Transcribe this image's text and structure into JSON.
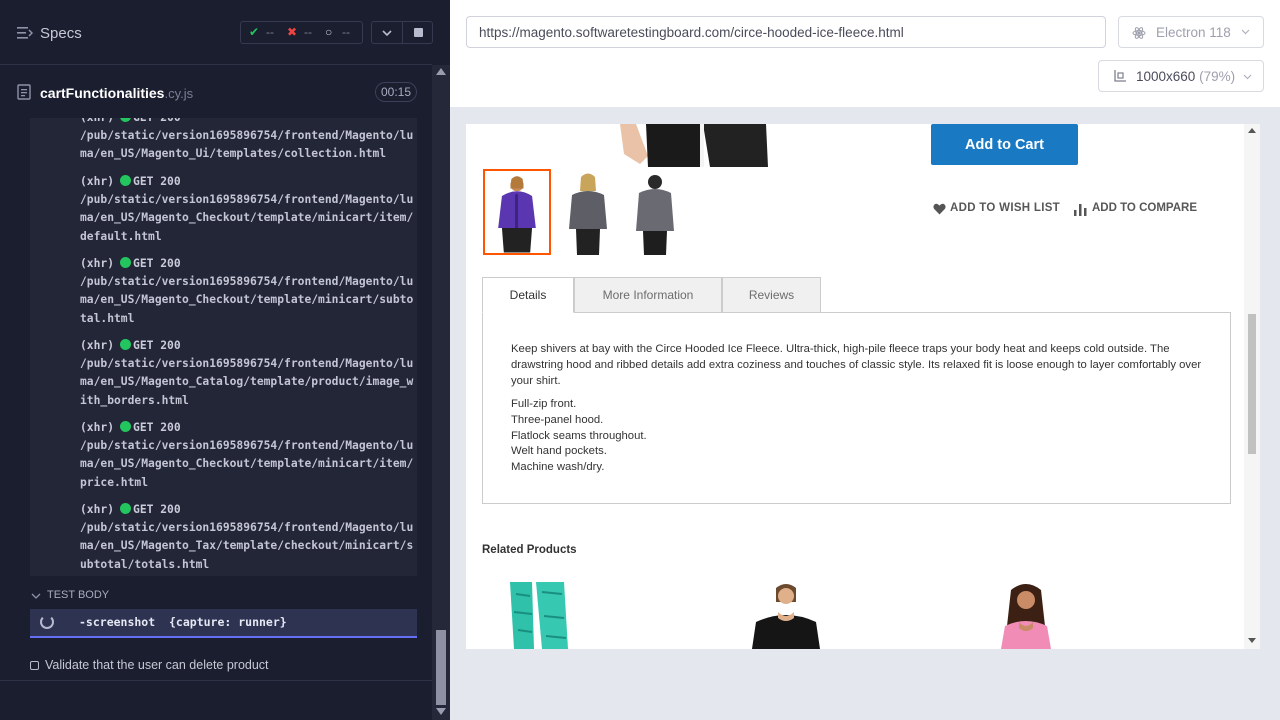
{
  "runner": {
    "specs_title": "Specs",
    "stats": {
      "passed": "--",
      "failed": "--",
      "pending": "--"
    },
    "file": {
      "name": "cartFunctionalities",
      "ext": ".cy.js",
      "timer": "00:15"
    },
    "log_partial_top": "(xhr) ● GET 200",
    "log_partial_path": "/pub/static/version1695896754/frontend/Magento/luma/en_US/Magento_Ui/templates/collection.html",
    "log_entries": [
      {
        "type": "(xhr)",
        "method": "GET 200",
        "path": "/pub/static/version1695896754/frontend/Magento/luma/en_US/Magento_Checkout/template/minicart/item/default.html"
      },
      {
        "type": "(xhr)",
        "method": "GET 200",
        "path": "/pub/static/version1695896754/frontend/Magento/luma/en_US/Magento_Checkout/template/minicart/subtotal.html"
      },
      {
        "type": "(xhr)",
        "method": "GET 200",
        "path": "/pub/static/version1695896754/frontend/Magento/luma/en_US/Magento_Catalog/template/product/image_with_borders.html"
      },
      {
        "type": "(xhr)",
        "method": "GET 200",
        "path": "/pub/static/version1695896754/frontend/Magento/luma/en_US/Magento_Checkout/template/minicart/item/price.html"
      },
      {
        "type": "(xhr)",
        "method": "GET 200",
        "path": "/pub/static/version1695896754/frontend/Magento/luma/en_US/Magento_Tax/template/checkout/minicart/subtotal/totals.html"
      }
    ],
    "test_body_label": "TEST BODY",
    "command": "-screenshot  {capture: runner}",
    "next_test": "Validate that the user can delete product"
  },
  "aut_header": {
    "url": "https://magento.softwaretestingboard.com/circe-hooded-ice-fleece.html",
    "browser": "Electron 118",
    "viewport": "1000x660",
    "viewport_pct": "(79%)"
  },
  "product": {
    "add_to_cart": "Add to Cart",
    "wish_list": "ADD TO WISH LIST",
    "compare": "ADD TO COMPARE",
    "tabs": [
      "Details",
      "More Information",
      "Reviews"
    ],
    "description": "Keep shivers at bay with the Circe Hooded Ice Fleece. Ultra-thick, high-pile fleece traps your body heat and keeps cold outside. The drawstring hood and ribbed details add extra coziness and touches of classic style. Its relaxed fit is loose enough to layer comfortably over your shirt.",
    "features": [
      "Full-zip front.",
      "Three-panel hood.",
      "Flatlock seams throughout.",
      "Welt hand pockets.",
      "Machine wash/dry."
    ],
    "related_title": "Related Products"
  },
  "colors": {
    "runner_bg": "#1b1e2e",
    "pass_green": "#22c55e",
    "fail_red": "#ef4444",
    "accent_indigo": "#6470f3",
    "luma_blue": "#1979c3",
    "thumb_active": "#ff5501"
  },
  "icons": [
    "specs-icon",
    "check-icon",
    "x-icon",
    "spinner-icon",
    "chevron-down-icon",
    "stop-icon",
    "file-icon",
    "electron-icon",
    "viewport-icon",
    "heart-icon",
    "compare-icon"
  ]
}
